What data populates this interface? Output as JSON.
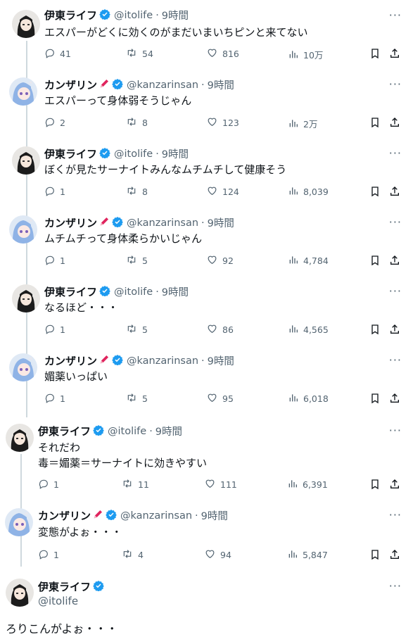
{
  "users": {
    "ito": {
      "name": "伊東ライフ",
      "handle": "@itolife"
    },
    "kanzarin": {
      "name": "カンザリン",
      "handle": "@kanzarinsan"
    }
  },
  "time_label": "9時間",
  "tweets": [
    {
      "text": "エスパーがどくに効くのがまだいまいちピンと来てない",
      "replies": "41",
      "retweets": "54",
      "likes": "816",
      "views": "10万"
    },
    {
      "text": "エスパーって身体弱そうじゃん",
      "replies": "2",
      "retweets": "8",
      "likes": "123",
      "views": "2万"
    },
    {
      "text": "ぼくが見たサーナイトみんなムチムチして健康そう",
      "replies": "1",
      "retweets": "8",
      "likes": "124",
      "views": "8,039"
    },
    {
      "text": "ムチムチって身体柔らかいじゃん",
      "replies": "1",
      "retweets": "5",
      "likes": "92",
      "views": "4,784"
    },
    {
      "text": "なるほど・・・",
      "replies": "1",
      "retweets": "5",
      "likes": "86",
      "views": "4,565"
    },
    {
      "text": "媚薬いっぱい",
      "replies": "1",
      "retweets": "5",
      "likes": "95",
      "views": "6,018"
    },
    {
      "text_line1": "それだわ",
      "text_line2": "毒＝媚薬＝サーナイトに効きやすい",
      "replies": "1",
      "retweets": "11",
      "likes": "111",
      "views": "6,391"
    },
    {
      "text": "変態がよぉ・・・",
      "replies": "1",
      "retweets": "4",
      "likes": "94",
      "views": "5,847"
    }
  ],
  "main_tweet": {
    "text": "ろりこんがよぉ・・・"
  },
  "icons": {
    "reply": "reply-icon",
    "retweet": "retweet-icon",
    "like": "heart-icon",
    "views": "views-icon",
    "bookmark": "bookmark-icon",
    "share": "share-icon",
    "more": "more-icon",
    "verified": "verified-badge-icon",
    "pen": "red-pen-icon"
  },
  "colors": {
    "verified": "#1d9bf0",
    "pen": "#e0245e",
    "secondary": "#536471",
    "thread": "#cfd9de"
  }
}
